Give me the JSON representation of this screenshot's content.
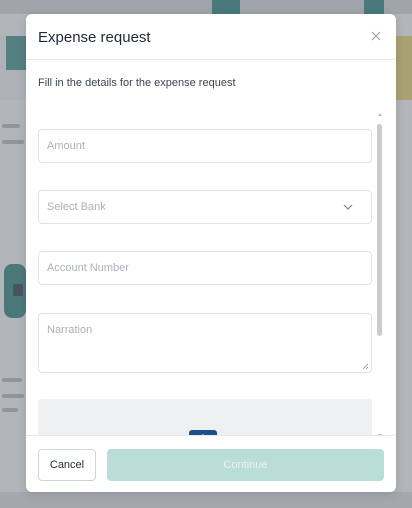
{
  "modal": {
    "title": "Expense request",
    "subtitle": "Fill in the details for the expense request",
    "fields": {
      "amount": {
        "placeholder": "Amount",
        "value": ""
      },
      "bank": {
        "placeholder": "Select Bank",
        "selected": ""
      },
      "account_number": {
        "placeholder": "Account Number",
        "value": ""
      },
      "narration": {
        "placeholder": "Narration",
        "value": ""
      }
    },
    "footer": {
      "cancel_label": "Cancel",
      "continue_label": "Continue"
    }
  },
  "icons": {
    "close": "close-icon",
    "chevron": "chevron-down-icon",
    "upload": "upload-icon"
  },
  "colors": {
    "primary_disabled": "#b9ddd9",
    "upload_icon": "#1f4f8a",
    "text": "#1f2a37",
    "placeholder": "#a9b1bb"
  }
}
